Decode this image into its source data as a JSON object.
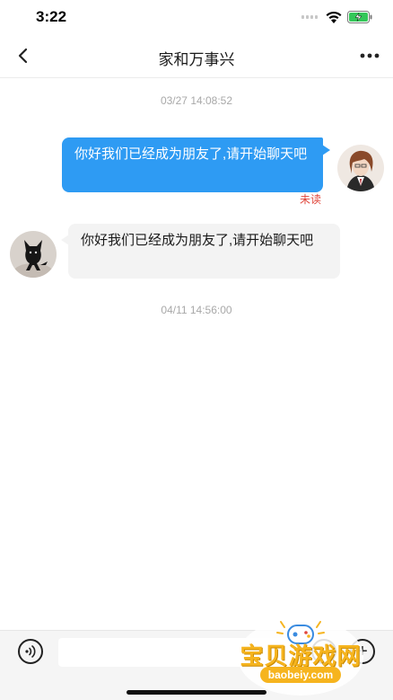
{
  "status_bar": {
    "time": "3:22",
    "icons": [
      "signal-icon",
      "wifi-icon",
      "battery-charging-icon"
    ]
  },
  "nav": {
    "title": "家和万事兴",
    "back_icon": "chevron-left-icon",
    "more_icon": "more-dots-icon"
  },
  "messages": [
    {
      "timestamp": "03/27 14:08:52"
    },
    {
      "sender": "self",
      "text": "你好我们已经成为朋友了,请开始聊天吧",
      "status": "未读",
      "bubble_color": "#2e9bf3"
    },
    {
      "sender": "friend",
      "text": "你好我们已经成为朋友了,请开始聊天吧",
      "bubble_color": "#f3f3f3"
    },
    {
      "timestamp": "04/11 14:56:00"
    }
  ],
  "input_bar": {
    "voice_icon": "voice-icon",
    "input_value": "",
    "emoji_icon": "emoji-icon",
    "plus_icon": "plus-icon",
    "plus_label": "+"
  },
  "watermark": {
    "text": "宝贝游戏网",
    "domain": "baobeiy.com"
  },
  "colors": {
    "accent": "#2e9bf3",
    "unread": "#e0463b",
    "timestamp": "#a8a8a8",
    "watermark": "#f6b41e"
  }
}
